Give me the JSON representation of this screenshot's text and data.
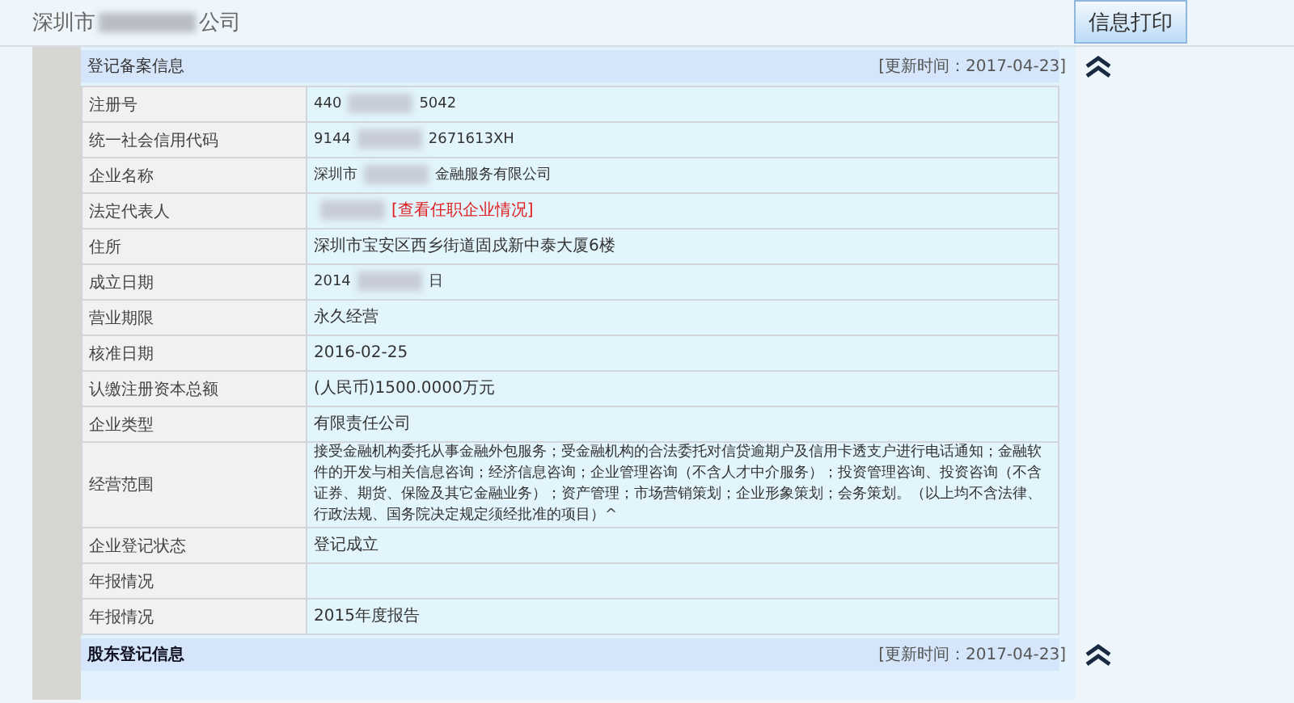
{
  "company_title": [
    "深圳市",
    "公司"
  ],
  "print_button": "信息打印",
  "sections": [
    {
      "title": "登记备案信息",
      "updated": "[更新时间：2017-04-23]",
      "expanded": true,
      "rows": [
        {
          "label": "注册号",
          "value": [
            "440",
            "5042"
          ]
        },
        {
          "label": "统一社会信用代码",
          "value": [
            "9144",
            "2671613XH"
          ]
        },
        {
          "label": "企业名称",
          "value": [
            "深圳市",
            "金融服务有限公司"
          ]
        },
        {
          "label": "法定代表人",
          "value": [
            "[查看任职企业情况]"
          ],
          "blurred_prefix": true,
          "link": true
        },
        {
          "label": "住所",
          "value": [
            "深圳市宝安区西乡街道固戍新中泰大厦6楼"
          ]
        },
        {
          "label": "成立日期",
          "value": [
            "2014",
            "日"
          ]
        },
        {
          "label": "营业期限",
          "value": [
            "永久经营"
          ]
        },
        {
          "label": "核准日期",
          "value": [
            "2016-02-25"
          ]
        },
        {
          "label": "认缴注册资本总额",
          "value": [
            "(人民币)1500.0000万元"
          ]
        },
        {
          "label": "企业类型",
          "value": [
            "有限责任公司"
          ]
        },
        {
          "label": "经营范围",
          "value": [
            "接受金融机构委托从事金融外包服务；受金融机构的合法委托对信贷逾期户及信用卡透支户进行电话通知；金融软件的开发与相关信息咨询；经济信息咨询；企业管理咨询（不含人才中介服务）；投资管理咨询、投资咨询（不含证券、期货、保险及其它金融业务）；资产管理；市场营销策划；企业形象策划；会务策划。（以上均不含法律、行政法规、国务院决定规定须经批准的项目）^"
          ]
        },
        {
          "label": "企业登记状态",
          "value": [
            "登记成立"
          ]
        },
        {
          "label": "年报情况",
          "value": []
        },
        {
          "label": "年报情况",
          "value": [
            "2015年度报告"
          ]
        }
      ]
    },
    {
      "title": "股东登记信息",
      "updated": "[更新时间：2017-04-23]",
      "expanded": true
    }
  ]
}
